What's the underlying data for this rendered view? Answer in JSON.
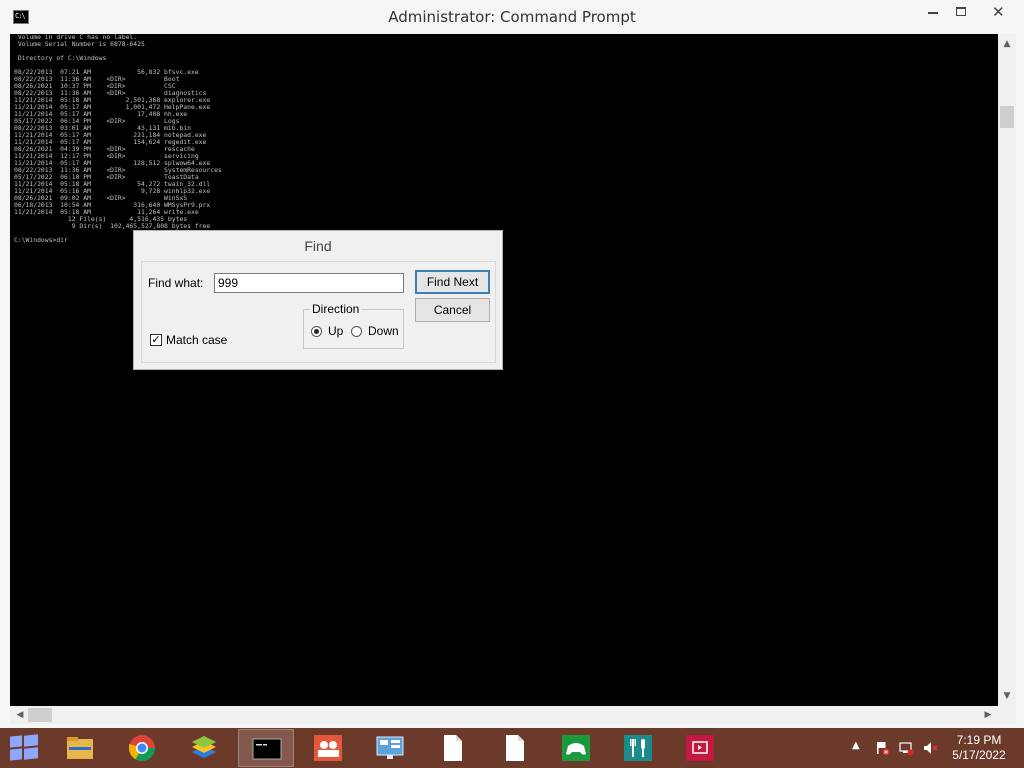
{
  "window": {
    "title": "Administrator: Command Prompt",
    "icon_text": "C:\\",
    "min_icon": "minimize-icon",
    "max_icon": "maximize-icon",
    "close_glyph": "✕"
  },
  "console": {
    "lines": [
      " Volume in drive C has no label.",
      " Volume Serial Number is 6878-6425",
      "",
      " Directory of C:\\Windows",
      "",
      "08/22/2013  07:21 AM            56,832 bfsvc.exe",
      "08/22/2013  11:36 AM    <DIR>          Boot",
      "08/26/2021  10:37 PM    <DIR>          CSC",
      "08/22/2013  11:36 AM    <DIR>          diagnostics",
      "11/21/2014  05:18 AM         2,501,368 explorer.exe",
      "11/21/2014  05:17 AM         1,001,472 HelpPane.exe",
      "11/21/2014  05:17 AM            17,408 hh.exe",
      "05/17/2022  06:14 PM    <DIR>          Logs",
      "08/22/2013  03:01 AM            43,131 mib.bin",
      "11/21/2014  05:17 AM           221,184 notepad.exe",
      "11/21/2014  05:17 AM           154,624 regedit.exe",
      "08/26/2021  04:39 PM    <DIR>          rescache",
      "11/21/2014  12:17 PM    <DIR>          servicing",
      "11/21/2014  05:17 AM           128,512 splwow64.exe",
      "08/22/2013  11:36 AM    <DIR>          SystemResources",
      "05/17/2022  06:10 PM    <DIR>          ToastData",
      "11/21/2014  05:18 AM            54,272 twain_32.dll",
      "11/21/2014  05:16 AM             9,728 winhlp32.exe",
      "08/26/2021  09:02 AM    <DIR>          WinSxS",
      "06/18/2013  10:54 AM           316,640 WMSysPr9.prx",
      "11/21/2014  05:18 AM            11,264 write.exe",
      "              12 File(s)      4,516,435 bytes",
      "               9 Dir(s)  102,465,527,808 bytes free",
      "",
      "C:\\Windows>dir"
    ],
    "scroll_up_glyph": "▲",
    "scroll_down_glyph": "▼",
    "scroll_left_glyph": "◀",
    "scroll_right_glyph": "▶"
  },
  "find_dialog": {
    "title": "Find",
    "find_what_label": "Find what:",
    "find_what_value": "999",
    "find_next_label": "Find Next",
    "cancel_label": "Cancel",
    "direction_label": "Direction",
    "up_label": "Up",
    "down_label": "Down",
    "direction_selected": "Up",
    "match_case_label": "Match case",
    "match_case_checked": true,
    "check_glyph": "✓"
  },
  "taskbar": {
    "items": [
      {
        "name": "file-explorer-icon",
        "active": false
      },
      {
        "name": "chrome-icon",
        "active": false
      },
      {
        "name": "bluestacks-icon",
        "active": false
      },
      {
        "name": "command-prompt-icon",
        "active": true
      },
      {
        "name": "people-icon",
        "active": false
      },
      {
        "name": "control-panel-icon",
        "active": false
      },
      {
        "name": "document-icon",
        "active": false
      },
      {
        "name": "document-icon",
        "active": false
      },
      {
        "name": "xbox-games-icon",
        "active": false
      },
      {
        "name": "food-drink-icon",
        "active": false
      },
      {
        "name": "video-icon",
        "active": false
      }
    ],
    "tray_arrow": "▲",
    "time": "7:19 PM",
    "date": "5/17/2022"
  },
  "colors": {
    "taskbar": "#6b3a2a",
    "console_bg": "#000000",
    "console_text": "#c0c0c0"
  }
}
